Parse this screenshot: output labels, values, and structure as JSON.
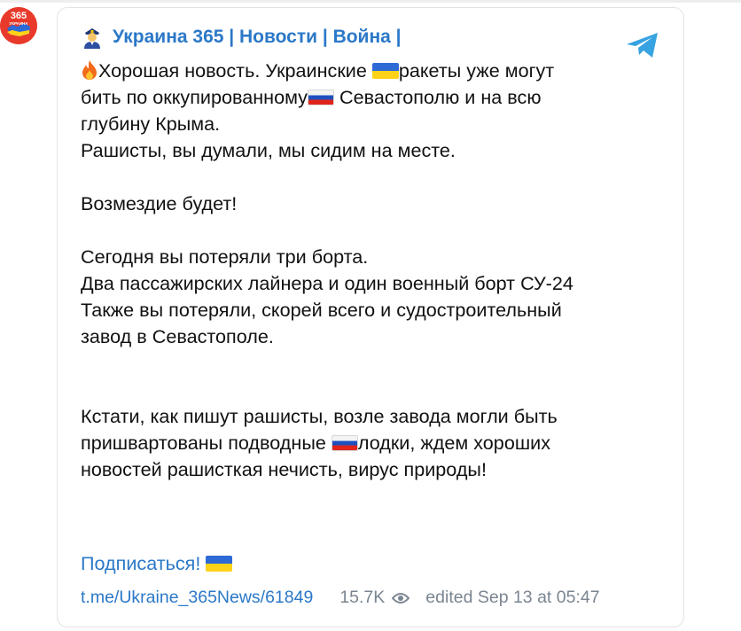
{
  "channel": {
    "avatar_text": "365",
    "avatar_subtext": "УКРАИНА",
    "title": "Украина 365 | Новости | Война |"
  },
  "post": {
    "line1": "Хорошая новость. Украинские ",
    "line1b": "ракеты уже могут",
    "line2": "бить по оккупированному",
    "line2b": " Севастополю и на всю",
    "line3": "глубину Крыма.",
    "line4": "Рашисты, вы думали, мы сидим на месте.",
    "line5": "Возмездие будет!",
    "line6": "Сегодня вы потеряли три борта.",
    "line7": "Два пассажирских лайнера и один военный борт СУ-24",
    "line8": "Также вы потеряли, скорей всего и судостроительный",
    "line9": "завод в Севастополе.",
    "line10": "Кстати, как пишут рашисты, возле завода могли быть",
    "line11a": "пришвартованы подводные ",
    "line11b": "лодки, ждем хороших",
    "line12": "новостей рашисткая нечисть, вирус природы!"
  },
  "subscribe_label": "Подписаться! ",
  "footer": {
    "link": "t.me/Ukraine_365News/61849",
    "views": "15.7K",
    "edited": "edited  Sep 13 at 05:47"
  },
  "icons": [
    "fire-icon",
    "ukraine-flag-icon",
    "russia-flag-icon",
    "police-officer-icon",
    "telegram-icon",
    "eye-icon"
  ],
  "colors": {
    "link": "#2b78c8",
    "meta": "#7a8591",
    "avatar_bg": "#e8392b",
    "telegram": "#37a3e0"
  }
}
